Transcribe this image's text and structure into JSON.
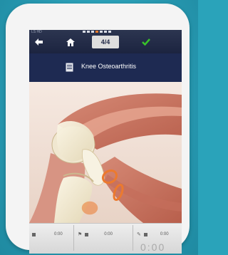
{
  "status_bar": {
    "left_text": "LS HD"
  },
  "nav": {
    "page_indicator": "4/4",
    "back_icon": "arrow-left-icon",
    "home_icon": "home-icon",
    "confirm_icon": "checkmark-icon"
  },
  "header": {
    "title": "Knee Osteoarthritis",
    "doc_icon": "document-icon"
  },
  "timeline": {
    "clips": [
      {
        "time": "0:00"
      },
      {
        "time": "0:00"
      },
      {
        "time": "0:00"
      }
    ],
    "big_time": "0:00"
  },
  "colors": {
    "background": "#2aa3ba",
    "header": "#1e2a52",
    "accent": "#e87b2c",
    "confirm": "#39c22a"
  }
}
